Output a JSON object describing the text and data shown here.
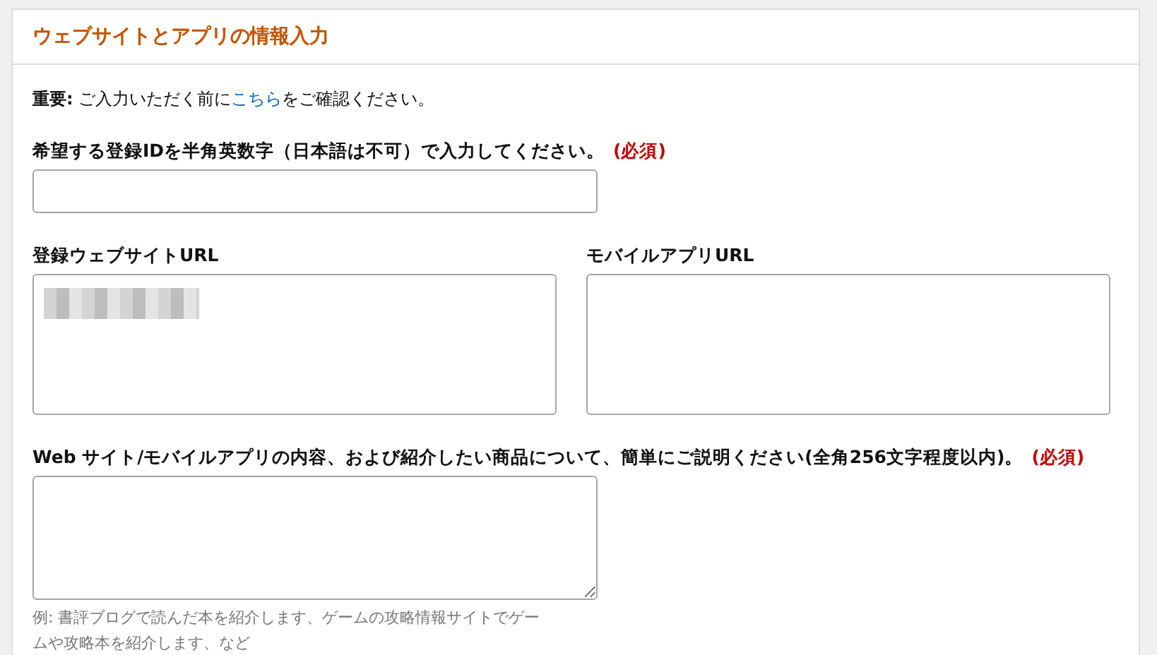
{
  "panel": {
    "title": "ウェブサイトとアプリの情報入力"
  },
  "notice": {
    "text_before": "**重要:** ご入力いただく前に",
    "link": "こちら",
    "text_after": "をご確認ください。"
  },
  "rows": [
    {
      "fields": [
        {
          "kind": "input",
          "label": "希望する登録IDを半角英数字（日本語は不可）で入力してください。",
          "required_mark": "(必須)"
        }
      ]
    },
    {
      "fields": [
        {
          "kind": "textarea",
          "label": "登録ウェブサイトURL",
          "value_redacted": true,
          "resizable": false
        },
        {
          "kind": "textarea",
          "label": "モバイルアプリURL",
          "value_redacted": false,
          "resizable": false
        }
      ]
    },
    {
      "fields": [
        {
          "kind": "textarea",
          "label": "Web サイト/モバイルアプリの内容、および紹介したい商品について、簡単にご説明ください(全角256文字程度以内)。",
          "required_mark": "(必須)",
          "resizable": true,
          "hint": "例: 書評ブログで読んだ本を紹介します、ゲームの攻略情報サイトでゲームや攻略本を紹介します、など"
        }
      ]
    }
  ]
}
